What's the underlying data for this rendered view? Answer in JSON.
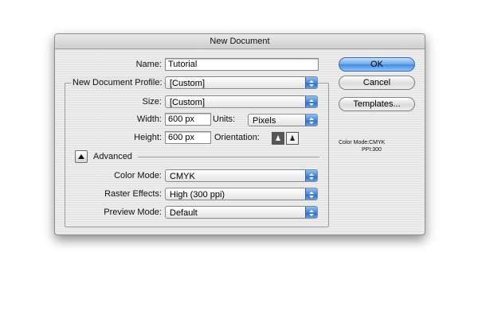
{
  "dialog": {
    "title": "New Document"
  },
  "name": {
    "label": "Name:",
    "value": "Tutorial"
  },
  "profile": {
    "label": "New Document Profile:",
    "value": "[Custom]"
  },
  "size": {
    "label": "Size:",
    "value": "[Custom]"
  },
  "width": {
    "label": "Width:",
    "value": "600 px"
  },
  "units": {
    "label": "Units:",
    "value": "Pixels"
  },
  "height": {
    "label": "Height:",
    "value": "600 px"
  },
  "orientation": {
    "label": "Orientation:",
    "portrait_icon": "portrait-icon",
    "landscape_icon": "landscape-icon",
    "selected": "portrait"
  },
  "advanced": {
    "label": "Advanced"
  },
  "color_mode": {
    "label": "Color Mode:",
    "value": "CMYK"
  },
  "raster_effects": {
    "label": "Raster Effects:",
    "value": "High (300 ppi)"
  },
  "preview_mode": {
    "label": "Preview Mode:",
    "value": "Default"
  },
  "buttons": {
    "ok": "OK",
    "cancel": "Cancel",
    "templates": "Templates..."
  },
  "info": {
    "color_mode": "Color Mode:CMYK",
    "ppi": "PPI:300"
  },
  "colors": {
    "accent": "#4a90e2",
    "dialog_bg": "#e5e5e5"
  }
}
